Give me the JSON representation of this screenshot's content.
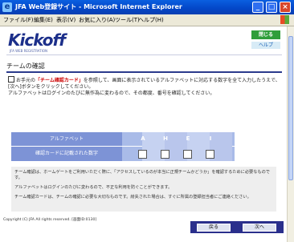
{
  "window": {
    "title": "JFA Web登録サイト - Microsoft Internet Explorer"
  },
  "menu": [
    "ファイル(F)",
    "編集(E)",
    "表示(V)",
    "お気に入り(A)",
    "ツール(T)",
    "ヘルプ(H)"
  ],
  "header": {
    "logo": "Kickoff",
    "logo_sub": "JFA WEB REGISTRATION",
    "close_label": "閉じる",
    "help_label": "ヘルプ"
  },
  "page": {
    "section_title": "チームの確認",
    "instruction_prefix": "お手元の",
    "instruction_highlight": "「チーム確認カード」",
    "instruction_rest": "を参照して、画面に表示されているアルファベットに対応する数字を全て入力したうえで、[次へ]ボタンをクリックしてください。",
    "instruction_line2": "アルファベットはログインのたびに無作為に変わるので、その都度、番号を確認してください。"
  },
  "pin_table": {
    "header_label": "アルファベット",
    "row_label": "確認カードに記載された数字",
    "letters": [
      "A",
      "H",
      "E",
      "I"
    ]
  },
  "notes": [
    "チーム確認は、ホームゲートをご利用いただく際に、「アクセスしているのが本当に正規チームかどうか」を確認するために必要なものです。",
    "アルファベットはログインのたびに変わるので、不正な利用を防ぐことができます。",
    "チーム確認カードは、チームの確認に必要な大切なものです。紛失された場合は、すぐに所属の登録担当者にご連絡ください。"
  ],
  "footer": {
    "copyright": "Copyright (C) JFA All rights reserved.",
    "screen_id": "[画面ID:0130]",
    "back_label": "戻る",
    "next_label": "次へ"
  }
}
